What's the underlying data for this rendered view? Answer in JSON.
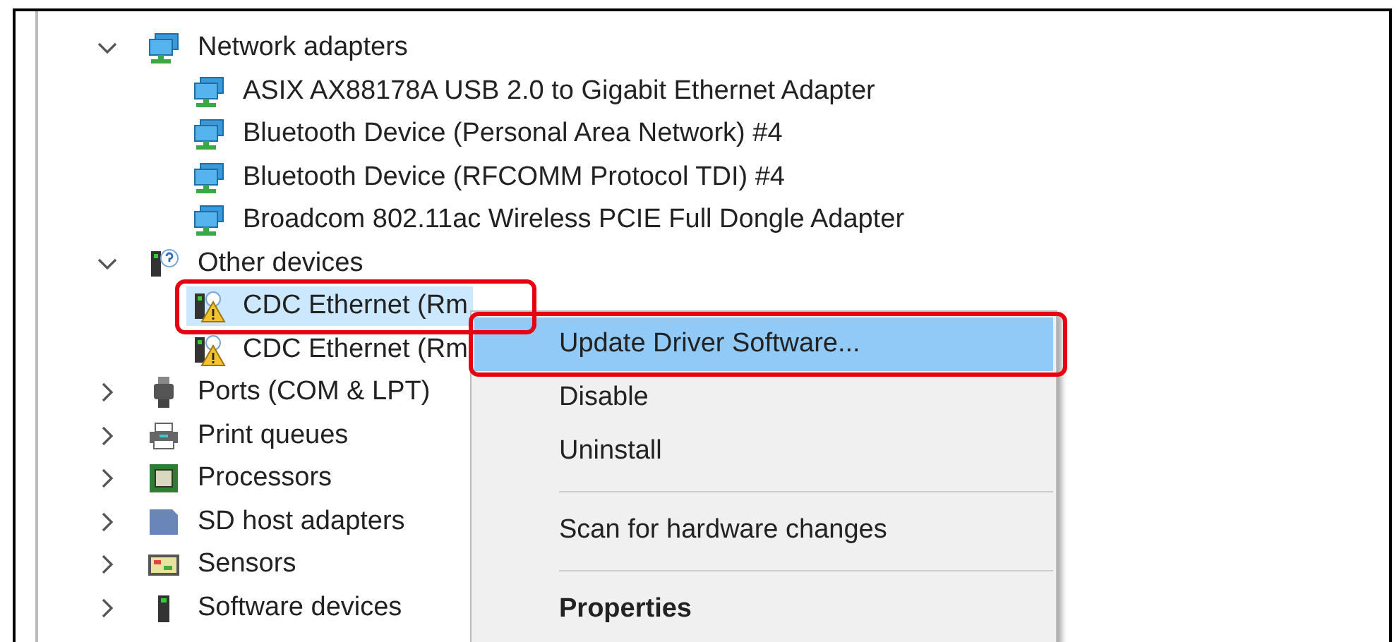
{
  "device_tree": [
    {
      "label": "Network adapters",
      "kind": "network",
      "expanded": true,
      "selected": false,
      "children": [
        {
          "label": "ASIX AX88178A USB 2.0 to Gigabit Ethernet Adapter",
          "kind": "network",
          "selected": false
        },
        {
          "label": "Bluetooth Device (Personal Area Network) #4",
          "kind": "network",
          "selected": false
        },
        {
          "label": "Bluetooth Device (RFCOMM Protocol TDI) #4",
          "kind": "network",
          "selected": false
        },
        {
          "label": "Broadcom 802.11ac Wireless PCIE Full Dongle Adapter",
          "kind": "network",
          "selected": false
        }
      ]
    },
    {
      "label": "Other devices",
      "kind": "unknown",
      "expanded": true,
      "selected": false,
      "children": [
        {
          "label": "CDC Ethernet (Rm",
          "kind": "warning",
          "selected": true,
          "annotated": true
        },
        {
          "label": "CDC Ethernet (Rm",
          "kind": "warning",
          "selected": false
        }
      ]
    },
    {
      "label": "Ports (COM & LPT)",
      "kind": "port",
      "expanded": false,
      "selected": false
    },
    {
      "label": "Print queues",
      "kind": "printer",
      "expanded": false,
      "selected": false
    },
    {
      "label": "Processors",
      "kind": "processor",
      "expanded": false,
      "selected": false
    },
    {
      "label": "SD host adapters",
      "kind": "sd",
      "expanded": false,
      "selected": false
    },
    {
      "label": "Sensors",
      "kind": "sensor",
      "expanded": false,
      "selected": false
    },
    {
      "label": "Software devices",
      "kind": "software",
      "expanded": false,
      "selected": false
    }
  ],
  "context_menu": {
    "items": [
      {
        "kind": "item",
        "label": "Update Driver Software...",
        "selected": true,
        "bold": false,
        "annotated": true
      },
      {
        "kind": "item",
        "label": "Disable",
        "selected": false,
        "bold": false
      },
      {
        "kind": "item",
        "label": "Uninstall",
        "selected": false,
        "bold": false
      },
      {
        "kind": "separator"
      },
      {
        "kind": "item",
        "label": "Scan for hardware changes",
        "selected": false,
        "bold": false
      },
      {
        "kind": "separator"
      },
      {
        "kind": "item",
        "label": "Properties",
        "selected": false,
        "bold": true
      }
    ]
  }
}
